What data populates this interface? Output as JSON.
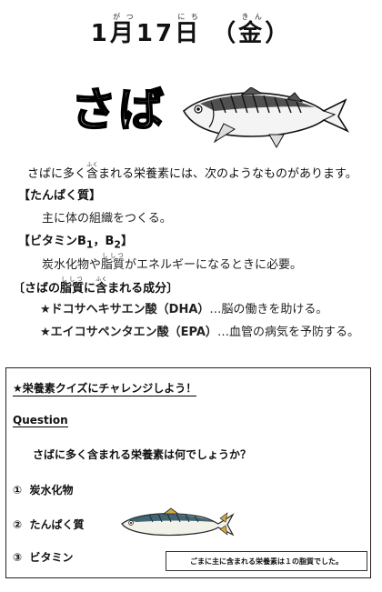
{
  "header": {
    "month": "1",
    "month_char": "月",
    "month_ruby": "がつ",
    "day": "17",
    "day_char": "日",
    "day_ruby": "にち",
    "weekday_open": "（",
    "weekday_char": "金",
    "weekday_ruby": "きん",
    "weekday_close": "）"
  },
  "title": {
    "text": "さば",
    "icon": "mackerel-fish-illustration"
  },
  "intro": {
    "pre": "さばに多く",
    "ruby_base": "含",
    "ruby": "ふく",
    "post": "まれる栄養素には、次のようなものがあります。"
  },
  "sections": {
    "protein": {
      "heading": "【たんぱく質】",
      "body": "主に体の組織をつくる。"
    },
    "vitamin": {
      "heading_pre": "【ビタミンB",
      "sub1": "1",
      "heading_mid": "，B",
      "sub2": "2",
      "heading_post": "】",
      "body_pre": "炭水化物や",
      "ruby_base": "脂質",
      "ruby": "ししつ",
      "body_post": "がエネルギーになるときに必要。"
    },
    "lipid": {
      "heading_pre": "〔さばの",
      "ruby_base1": "脂質",
      "ruby1": "ししつ",
      "heading_mid": "に",
      "ruby_base2": "含",
      "ruby2": "ふく",
      "heading_post": "まれる成分〕",
      "items": [
        {
          "name": "★ドコサヘキサエン酸（DHA）",
          "desc": "…脳の働きを助ける。"
        },
        {
          "name": "★エイコサペンタエン酸（EPA）",
          "desc": "…血管の病気を予防する。"
        }
      ]
    }
  },
  "quiz": {
    "title": "★栄養素クイズにチャレンジしよう！",
    "label": "Question",
    "question": "さばに多く含まれる栄養素は何でしょうか？",
    "options": [
      {
        "num": "①",
        "text": "炭水化物"
      },
      {
        "num": "②",
        "text": "たんぱく質"
      },
      {
        "num": "③",
        "text": "ビタミン"
      }
    ],
    "answer": "ごまに主に含まれる栄養素は１の脂質でした。",
    "icon": "mackerel-fish-illustration"
  }
}
